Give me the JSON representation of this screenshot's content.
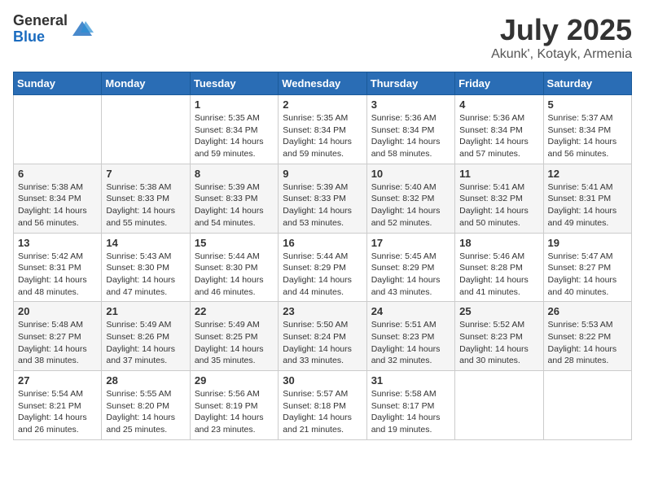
{
  "logo": {
    "general": "General",
    "blue": "Blue"
  },
  "title": "July 2025",
  "location": "Akunk', Kotayk, Armenia",
  "weekdays": [
    "Sunday",
    "Monday",
    "Tuesday",
    "Wednesday",
    "Thursday",
    "Friday",
    "Saturday"
  ],
  "weeks": [
    [
      {
        "day": "",
        "info": ""
      },
      {
        "day": "",
        "info": ""
      },
      {
        "day": "1",
        "info": "Sunrise: 5:35 AM\nSunset: 8:34 PM\nDaylight: 14 hours and 59 minutes."
      },
      {
        "day": "2",
        "info": "Sunrise: 5:35 AM\nSunset: 8:34 PM\nDaylight: 14 hours and 59 minutes."
      },
      {
        "day": "3",
        "info": "Sunrise: 5:36 AM\nSunset: 8:34 PM\nDaylight: 14 hours and 58 minutes."
      },
      {
        "day": "4",
        "info": "Sunrise: 5:36 AM\nSunset: 8:34 PM\nDaylight: 14 hours and 57 minutes."
      },
      {
        "day": "5",
        "info": "Sunrise: 5:37 AM\nSunset: 8:34 PM\nDaylight: 14 hours and 56 minutes."
      }
    ],
    [
      {
        "day": "6",
        "info": "Sunrise: 5:38 AM\nSunset: 8:34 PM\nDaylight: 14 hours and 56 minutes."
      },
      {
        "day": "7",
        "info": "Sunrise: 5:38 AM\nSunset: 8:33 PM\nDaylight: 14 hours and 55 minutes."
      },
      {
        "day": "8",
        "info": "Sunrise: 5:39 AM\nSunset: 8:33 PM\nDaylight: 14 hours and 54 minutes."
      },
      {
        "day": "9",
        "info": "Sunrise: 5:39 AM\nSunset: 8:33 PM\nDaylight: 14 hours and 53 minutes."
      },
      {
        "day": "10",
        "info": "Sunrise: 5:40 AM\nSunset: 8:32 PM\nDaylight: 14 hours and 52 minutes."
      },
      {
        "day": "11",
        "info": "Sunrise: 5:41 AM\nSunset: 8:32 PM\nDaylight: 14 hours and 50 minutes."
      },
      {
        "day": "12",
        "info": "Sunrise: 5:41 AM\nSunset: 8:31 PM\nDaylight: 14 hours and 49 minutes."
      }
    ],
    [
      {
        "day": "13",
        "info": "Sunrise: 5:42 AM\nSunset: 8:31 PM\nDaylight: 14 hours and 48 minutes."
      },
      {
        "day": "14",
        "info": "Sunrise: 5:43 AM\nSunset: 8:30 PM\nDaylight: 14 hours and 47 minutes."
      },
      {
        "day": "15",
        "info": "Sunrise: 5:44 AM\nSunset: 8:30 PM\nDaylight: 14 hours and 46 minutes."
      },
      {
        "day": "16",
        "info": "Sunrise: 5:44 AM\nSunset: 8:29 PM\nDaylight: 14 hours and 44 minutes."
      },
      {
        "day": "17",
        "info": "Sunrise: 5:45 AM\nSunset: 8:29 PM\nDaylight: 14 hours and 43 minutes."
      },
      {
        "day": "18",
        "info": "Sunrise: 5:46 AM\nSunset: 8:28 PM\nDaylight: 14 hours and 41 minutes."
      },
      {
        "day": "19",
        "info": "Sunrise: 5:47 AM\nSunset: 8:27 PM\nDaylight: 14 hours and 40 minutes."
      }
    ],
    [
      {
        "day": "20",
        "info": "Sunrise: 5:48 AM\nSunset: 8:27 PM\nDaylight: 14 hours and 38 minutes."
      },
      {
        "day": "21",
        "info": "Sunrise: 5:49 AM\nSunset: 8:26 PM\nDaylight: 14 hours and 37 minutes."
      },
      {
        "day": "22",
        "info": "Sunrise: 5:49 AM\nSunset: 8:25 PM\nDaylight: 14 hours and 35 minutes."
      },
      {
        "day": "23",
        "info": "Sunrise: 5:50 AM\nSunset: 8:24 PM\nDaylight: 14 hours and 33 minutes."
      },
      {
        "day": "24",
        "info": "Sunrise: 5:51 AM\nSunset: 8:23 PM\nDaylight: 14 hours and 32 minutes."
      },
      {
        "day": "25",
        "info": "Sunrise: 5:52 AM\nSunset: 8:23 PM\nDaylight: 14 hours and 30 minutes."
      },
      {
        "day": "26",
        "info": "Sunrise: 5:53 AM\nSunset: 8:22 PM\nDaylight: 14 hours and 28 minutes."
      }
    ],
    [
      {
        "day": "27",
        "info": "Sunrise: 5:54 AM\nSunset: 8:21 PM\nDaylight: 14 hours and 26 minutes."
      },
      {
        "day": "28",
        "info": "Sunrise: 5:55 AM\nSunset: 8:20 PM\nDaylight: 14 hours and 25 minutes."
      },
      {
        "day": "29",
        "info": "Sunrise: 5:56 AM\nSunset: 8:19 PM\nDaylight: 14 hours and 23 minutes."
      },
      {
        "day": "30",
        "info": "Sunrise: 5:57 AM\nSunset: 8:18 PM\nDaylight: 14 hours and 21 minutes."
      },
      {
        "day": "31",
        "info": "Sunrise: 5:58 AM\nSunset: 8:17 PM\nDaylight: 14 hours and 19 minutes."
      },
      {
        "day": "",
        "info": ""
      },
      {
        "day": "",
        "info": ""
      }
    ]
  ]
}
